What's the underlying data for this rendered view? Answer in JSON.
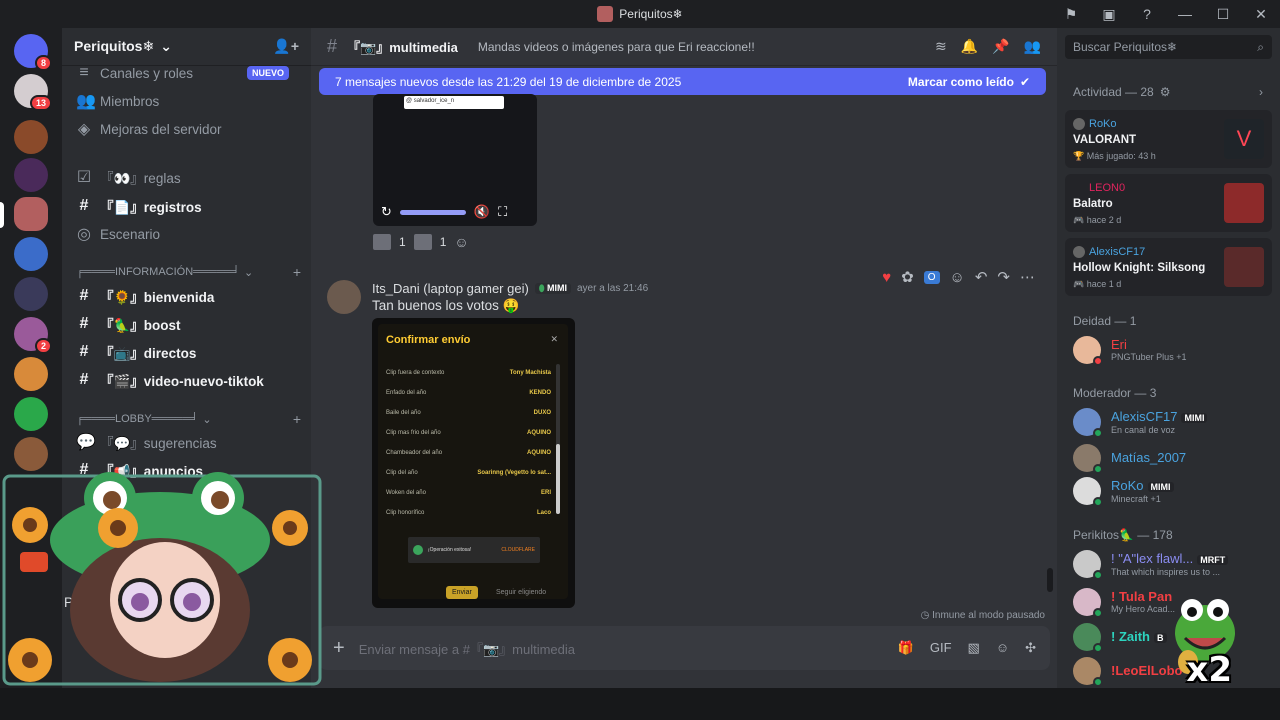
{
  "window": {
    "title": "Periquitos❄"
  },
  "server": {
    "name": "Periquitos❄"
  },
  "guild_badges": [
    "8",
    "13",
    "2"
  ],
  "channels": {
    "top": [
      {
        "label": "Canales y roles",
        "badge": "NUEVO"
      },
      {
        "label": "Miembros"
      },
      {
        "label": "Mejoras del servidor"
      }
    ],
    "list": [
      {
        "label": "『👀』reglas",
        "unread": false
      },
      {
        "label": "『📄』registros",
        "unread": true
      },
      {
        "label": "Escenario",
        "unread": false
      }
    ],
    "cat_info": "╒════INFORMACIÓN═════╛",
    "info": [
      {
        "label": "『🌻』bienvenida"
      },
      {
        "label": "『🦜』boost"
      },
      {
        "label": "『📺』directos"
      },
      {
        "label": "『🎬』video-nuevo-tiktok"
      }
    ],
    "cat_lobby": "╒════LOBBY═════╛",
    "lobby": [
      {
        "label": "『💬』sugerencias"
      },
      {
        "label": "『📢』anuncios"
      }
    ],
    "voice_prefix": "PN"
  },
  "chat": {
    "channel_name": "『📷』multimedia",
    "topic": "Mandas videos o imágenes para que Eri reaccione!!",
    "new_banner": "7 mensajes nuevos desde las 21:29 del 19 de diciembre de 2025",
    "mark_read": "Marcar como leído",
    "video_tag": "@ salvador_ice_n",
    "reactions": [
      {
        "count": "1"
      },
      {
        "count": "1"
      }
    ],
    "message": {
      "author": "Its_Dani (laptop gamer gei)",
      "tag": "MIMI",
      "timestamp": "ayer a las 21:46",
      "text": "Tan buenos los votos 🤑",
      "dialog": {
        "title": "Confirmar envío",
        "rows": [
          {
            "k": "Clip fuera de contexto",
            "v": "Tony Machista"
          },
          {
            "k": "Enfado del año",
            "v": "KENDO"
          },
          {
            "k": "Baile del año",
            "v": "DUXO"
          },
          {
            "k": "Clip mas frio del año",
            "v": "AQUINO"
          },
          {
            "k": "Chambeador del año",
            "v": "AQUINO"
          },
          {
            "k": "Clip del año",
            "v": "Soarinng (Vegetto lo sat..."
          },
          {
            "k": "Woken del año",
            "v": "ERI"
          },
          {
            "k": "Clip honorífico",
            "v": "Laco"
          }
        ],
        "captcha": "¡Operación exitosa!",
        "cf": "CLOUDFLARE",
        "confirm": "Enviar",
        "continue": "Seguir eligiendo"
      }
    },
    "immune": "Inmune al modo pausado",
    "placeholder": "Enviar mensaje a #『📷』multimedia"
  },
  "members": {
    "search": "Buscar Periquitos❄",
    "activity_header": "Actividad — 28",
    "activities": [
      {
        "user": "RoKo",
        "user_color": "#4aa3df",
        "game": "VALORANT",
        "sub": "Más jugado: 43 h",
        "art": "#1f2429"
      },
      {
        "user": "LEON0",
        "user_color": "#e0245e",
        "game": "Balatro",
        "sub": "hace 2 d",
        "art": "#8d2a2a"
      },
      {
        "user": "AlexisCF17",
        "user_color": "#4aa3df",
        "game": "Hollow Knight: Silksong",
        "sub": "hace 1 d",
        "art": "#5a2a2a"
      }
    ],
    "groups": [
      {
        "header": "Deidad — 1",
        "items": [
          {
            "name": "Eri",
            "color": "#f23f43",
            "sub": "PNGTuber Plus +1",
            "tag": ""
          }
        ]
      },
      {
        "header": "Moderador — 3",
        "items": [
          {
            "name": "AlexisCF17",
            "color": "#4aa3df",
            "sub": "En canal de voz",
            "tag": "MIMI"
          },
          {
            "name": "Matías_2007",
            "color": "#4aa3df",
            "sub": "",
            "tag": ""
          },
          {
            "name": "RoKo",
            "color": "#4aa3df",
            "sub": "Minecraft +1",
            "tag": "MIMI"
          }
        ]
      },
      {
        "header": "Perikitos🦜 — 178",
        "items": [
          {
            "name": "! \"A\"lex flawl...",
            "color": "#8b8df2",
            "sub": "That which inspires us to ...",
            "tag": "MRFT"
          },
          {
            "name": "! Tula Pan",
            "color": "#f23f43",
            "sub": "My Hero Acad...",
            "tag": ""
          },
          {
            "name": "! Zaith",
            "color": "#2dd4bf",
            "sub": "",
            "tag": "B"
          },
          {
            "name": "!LeoElLobo",
            "color": "#f23f43",
            "sub": "",
            "tag": ""
          }
        ]
      }
    ]
  },
  "overlay": {
    "multiplier": "x2"
  }
}
